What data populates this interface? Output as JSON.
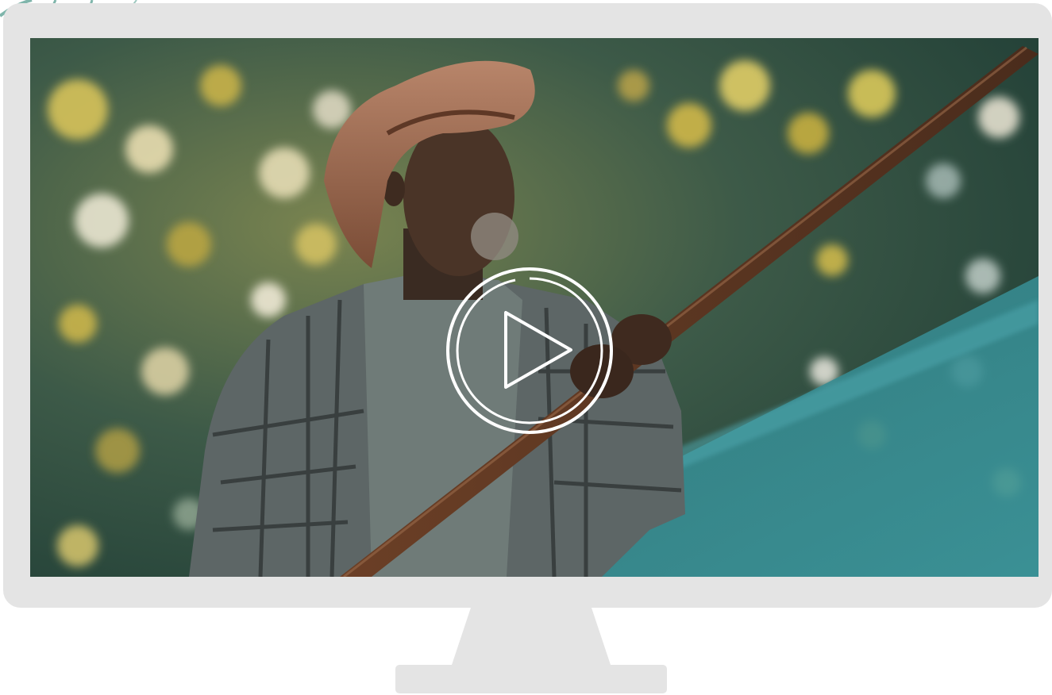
{
  "video": {
    "title": "",
    "state": "paused",
    "play_icon": "play-circle-icon"
  },
  "colors": {
    "monitor": "#e4e4e4",
    "play_icon": "#ffffff",
    "foliage_dark": "#233f33",
    "foliage_light": "#c9b64a",
    "water": "#3f8f95"
  }
}
